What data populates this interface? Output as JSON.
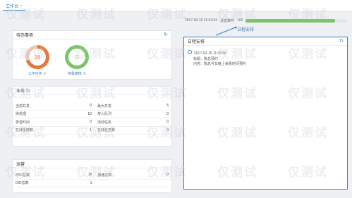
{
  "tabs": [
    {
      "label": "工作台",
      "close": "×"
    }
  ],
  "todo": {
    "title": "待办事项",
    "refresh_icon": "refresh-icon",
    "work_task": {
      "count": "26",
      "label": "工作任务 ≫",
      "color": "#e8763a"
    },
    "pending_audit": {
      "count": "0",
      "label": "待我审核 ≫",
      "color": "#7cc46a"
    }
  },
  "business": {
    "title": "业务",
    "rows": [
      {
        "l1": "当前并发",
        "v1": "0",
        "l2": "最大并发",
        "v2": "5"
      },
      {
        "l1": "待处理",
        "v1": "10",
        "l2": "排入队列",
        "v2": "0"
      },
      {
        "l1": "录音时间",
        "v1": "0",
        "l2": "活动任务",
        "v2": "0"
      },
      {
        "l1": "在线坐席数",
        "v1": "1",
        "l2": "在线任务数",
        "v2": "0"
      }
    ]
  },
  "operation": {
    "title": "运营",
    "rows": [
      {
        "l1": "呼叫总数",
        "v1": "10",
        "l2": "接通总数",
        "v2": "0"
      },
      {
        "l1": "DID总数",
        "v1": "1",
        "l2": "",
        "v2": ""
      }
    ]
  },
  "status": {
    "time": "2017-03-15 11:04:54",
    "label": "话音数呼",
    "value": "100",
    "progress_pct": 88
  },
  "callout": "日程安排",
  "schedule": {
    "title": "日程安排",
    "event": {
      "time": "2017-03-15 11:20:00",
      "title_line": "标题：陈总预约",
      "content_line": "内容：陈总今日晚上来看时间预约"
    }
  },
  "watermark": "仅测试"
}
